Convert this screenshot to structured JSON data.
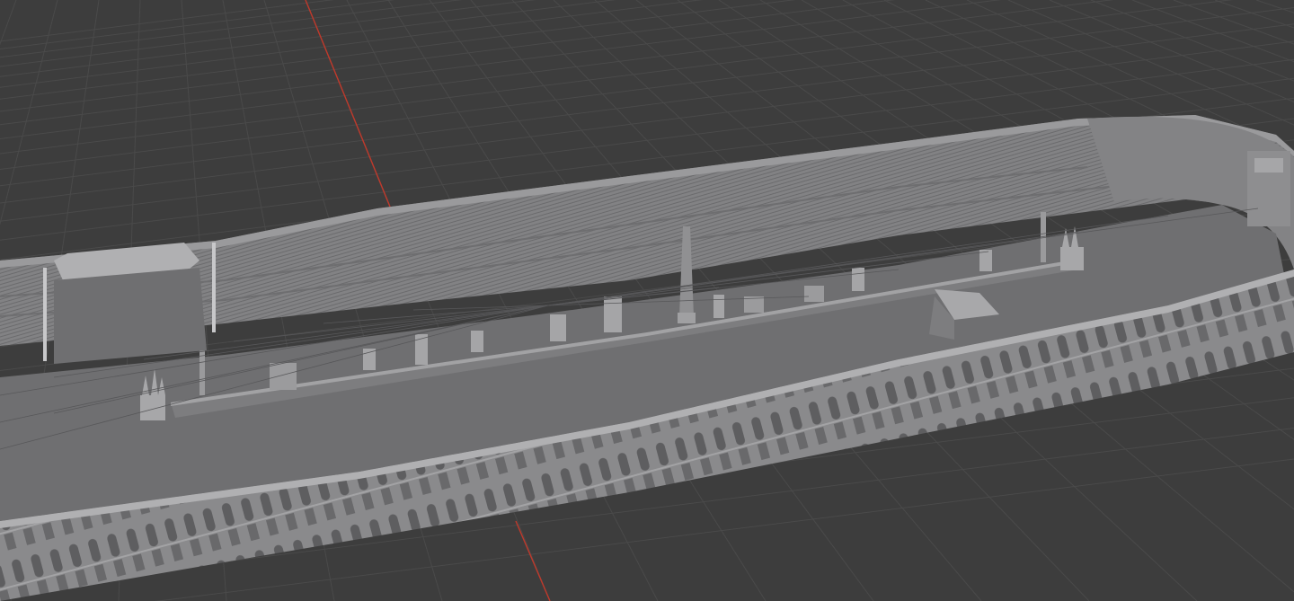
{
  "viewport": {
    "mode": "3d-viewport",
    "shading": "solid",
    "background_color": "#3d3d3d",
    "grid_color": "#4a4a4a",
    "x_axis_color": "#c0392b",
    "model_color": "#8c8c8e"
  },
  "scene": {
    "model": "circus-arena-model",
    "visible_objects": [
      "seating-tiers",
      "arcade-facade",
      "spina",
      "obelisk",
      "metae-turning-posts",
      "carceres-gate",
      "pulvinar-pavilion",
      "arena-floor"
    ]
  }
}
